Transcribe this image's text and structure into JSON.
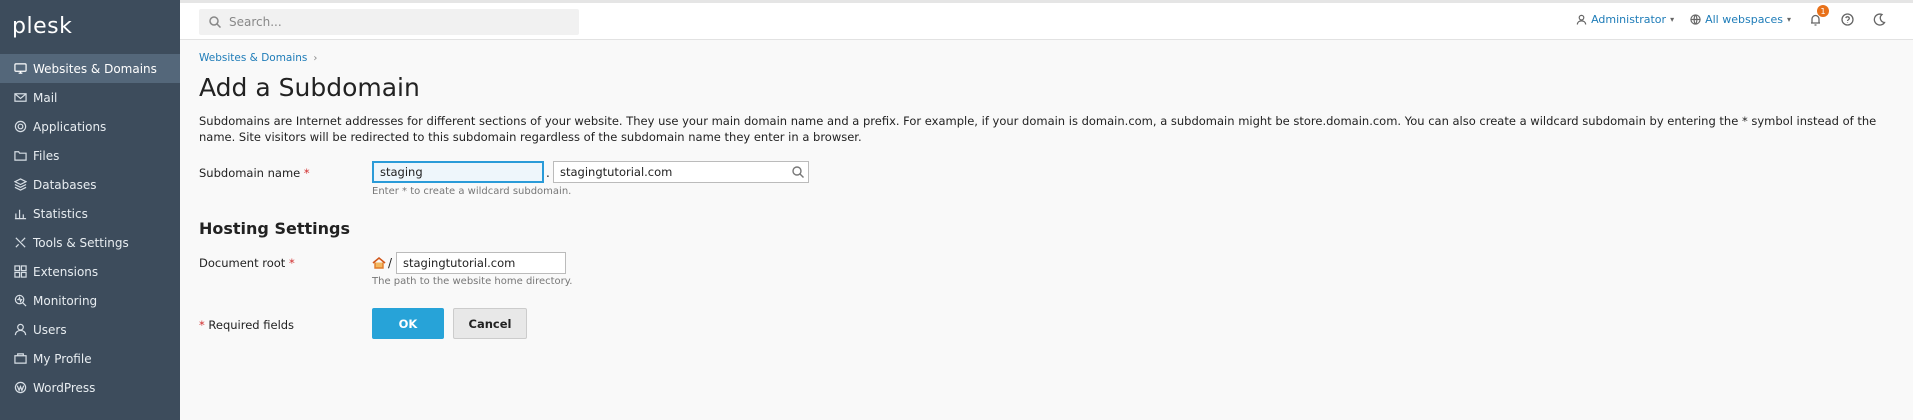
{
  "app": {
    "logo": "plesk"
  },
  "sidebar": {
    "items": [
      {
        "label": "Websites & Domains",
        "icon": "monitor-icon",
        "active": true
      },
      {
        "label": "Mail",
        "icon": "mail-icon"
      },
      {
        "label": "Applications",
        "icon": "gear-icon"
      },
      {
        "label": "Files",
        "icon": "folder-icon"
      },
      {
        "label": "Databases",
        "icon": "database-icon"
      },
      {
        "label": "Statistics",
        "icon": "bar-chart-icon"
      },
      {
        "label": "Tools & Settings",
        "icon": "tools-icon"
      },
      {
        "label": "Extensions",
        "icon": "puzzle-icon"
      },
      {
        "label": "Monitoring",
        "icon": "monitoring-icon"
      },
      {
        "label": "Users",
        "icon": "user-icon"
      },
      {
        "label": "My Profile",
        "icon": "profile-icon"
      },
      {
        "label": "WordPress",
        "icon": "wordpress-icon"
      }
    ]
  },
  "topbar": {
    "search_placeholder": "Search...",
    "user": "Administrator",
    "webspaces": "All webspaces",
    "notification_count": "1"
  },
  "main": {
    "breadcrumb": [
      "Websites & Domains"
    ],
    "title": "Add a Subdomain",
    "description": "Subdomains are Internet addresses for different sections of your website. They use your main domain name and a prefix. For example, if your domain is domain.com, a subdomain might be store.domain.com. You can also create a wildcard subdomain by entering the * symbol instead of the name. Site visitors will be redirected to this subdomain regardless of the subdomain name they enter in a browser.",
    "subdomain": {
      "label": "Subdomain name",
      "required_mark": "*",
      "value": "staging",
      "separator": ".",
      "domain_value": "stagingtutorial.com",
      "hint": "Enter * to create a wildcard subdomain."
    },
    "hosting": {
      "section_title": "Hosting Settings",
      "docroot_label": "Document root",
      "required_mark": "*",
      "path_prefix": "/",
      "docroot_value": "stagingtutorial.com",
      "hint": "The path to the website home directory."
    },
    "required_note": "Required fields",
    "required_mark": "*",
    "buttons": {
      "ok": "OK",
      "cancel": "Cancel"
    }
  },
  "colors": {
    "sidebar": "#3d4c5c",
    "accent": "#27a3d8",
    "link": "#1e7cb8",
    "badge": "#e8711a"
  }
}
